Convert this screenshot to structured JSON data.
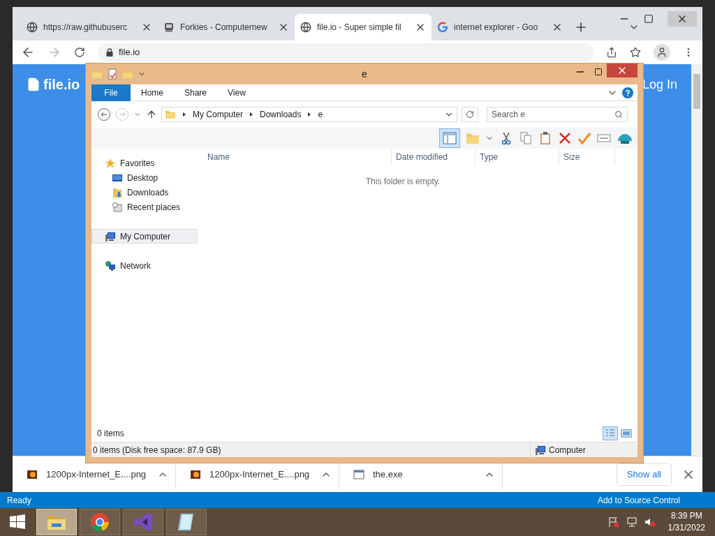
{
  "browser": {
    "tabs": [
      {
        "title": "https://raw.githubuserc",
        "kind": "globe",
        "selected": false
      },
      {
        "title": "Forkies - Computernew",
        "kind": "app",
        "selected": false
      },
      {
        "title": "file.io - Super simple fil",
        "kind": "globe",
        "selected": true
      },
      {
        "title": "internet explorer - Goo",
        "kind": "google",
        "selected": false
      }
    ],
    "address": "file.io",
    "page": {
      "logo": "file.io",
      "login": "Log In"
    },
    "downloads": [
      {
        "name": "1200px-Internet_E....png",
        "kind": "image"
      },
      {
        "name": "1200px-Internet_E....png",
        "kind": "image"
      },
      {
        "name": "the.exe",
        "kind": "program"
      }
    ],
    "show_all": "Show all"
  },
  "explorer": {
    "title": "e",
    "ribbon_tabs": [
      {
        "label": "File",
        "selected": true
      },
      {
        "label": "Home",
        "selected": false
      },
      {
        "label": "Share",
        "selected": false
      },
      {
        "label": "View",
        "selected": false
      }
    ],
    "breadcrumb": [
      "My Computer",
      "Downloads",
      "e"
    ],
    "search": {
      "placeholder": "Search e"
    },
    "nav": [
      {
        "label": "Favorites",
        "kind": "star",
        "selected": false,
        "children": [
          {
            "label": "Desktop",
            "kind": "desktop",
            "selected": false
          },
          {
            "label": "Downloads",
            "kind": "downloads",
            "selected": false
          },
          {
            "label": "Recent places",
            "kind": "recent",
            "selected": false
          }
        ]
      },
      {
        "label": "My Computer",
        "kind": "computer",
        "selected": true
      },
      {
        "label": "Network",
        "kind": "network",
        "selected": false
      }
    ],
    "columns": [
      "Name",
      "Date modified",
      "Type",
      "Size"
    ],
    "empty_message": "This folder is empty.",
    "item_count": "0 items",
    "status": "0 items (Disk free space: 87.9 GB)",
    "status_location": "Computer"
  },
  "vs_status": {
    "left": "Ready",
    "right": "Add to Source Control"
  },
  "taskbar": {
    "apps": [
      {
        "kind": "explorer",
        "selected": true
      },
      {
        "kind": "chrome",
        "selected": false
      },
      {
        "kind": "vs",
        "selected": false
      },
      {
        "kind": "notepad",
        "selected": false
      }
    ],
    "time": "8:39 PM",
    "date": "1/31/2022"
  }
}
